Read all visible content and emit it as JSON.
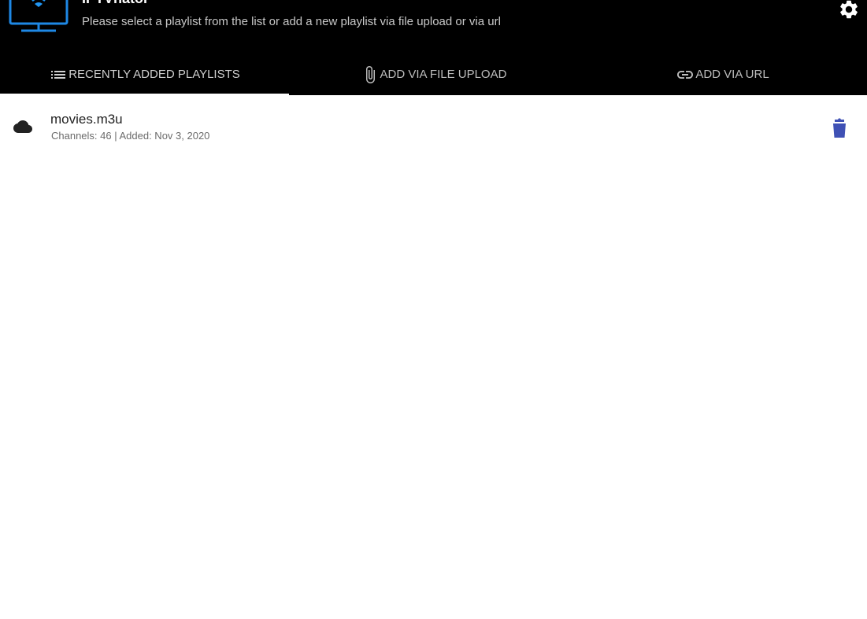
{
  "header": {
    "title": "IPTVnator",
    "subtitle": "Please select a playlist from the list or add a new playlist via file upload or via url",
    "logo_icon": "tv-wifi-icon",
    "settings_icon": "gear-icon"
  },
  "tabs": [
    {
      "label": "RECENTLY ADDED PLAYLISTS",
      "icon": "list-icon",
      "active": true
    },
    {
      "label": "ADD VIA FILE UPLOAD",
      "icon": "paperclip-icon",
      "active": false
    },
    {
      "label": "ADD VIA URL",
      "icon": "link-icon",
      "active": false
    }
  ],
  "playlists": [
    {
      "name": "movies.m3u",
      "meta": "Channels: 46 | Added: Nov 3, 2020",
      "icon": "cloud-icon",
      "delete_icon": "trash-icon"
    }
  ],
  "colors": {
    "header_bg": "#000000",
    "accent_blue": "#2196f3",
    "delete_blue": "#3f51b5",
    "tab_text": "#bdbdbd"
  }
}
